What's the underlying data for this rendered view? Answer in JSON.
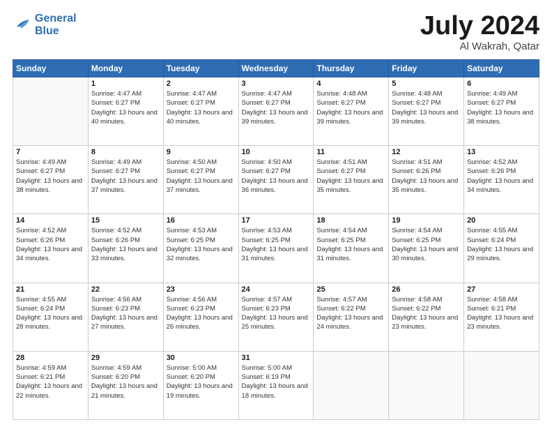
{
  "header": {
    "logo_line1": "General",
    "logo_line2": "Blue",
    "month": "July 2024",
    "location": "Al Wakrah, Qatar"
  },
  "weekdays": [
    "Sunday",
    "Monday",
    "Tuesday",
    "Wednesday",
    "Thursday",
    "Friday",
    "Saturday"
  ],
  "weeks": [
    [
      {
        "day": "",
        "sunrise": "",
        "sunset": "",
        "daylight": ""
      },
      {
        "day": "1",
        "sunrise": "Sunrise: 4:47 AM",
        "sunset": "Sunset: 6:27 PM",
        "daylight": "Daylight: 13 hours and 40 minutes."
      },
      {
        "day": "2",
        "sunrise": "Sunrise: 4:47 AM",
        "sunset": "Sunset: 6:27 PM",
        "daylight": "Daylight: 13 hours and 40 minutes."
      },
      {
        "day": "3",
        "sunrise": "Sunrise: 4:47 AM",
        "sunset": "Sunset: 6:27 PM",
        "daylight": "Daylight: 13 hours and 39 minutes."
      },
      {
        "day": "4",
        "sunrise": "Sunrise: 4:48 AM",
        "sunset": "Sunset: 6:27 PM",
        "daylight": "Daylight: 13 hours and 39 minutes."
      },
      {
        "day": "5",
        "sunrise": "Sunrise: 4:48 AM",
        "sunset": "Sunset: 6:27 PM",
        "daylight": "Daylight: 13 hours and 39 minutes."
      },
      {
        "day": "6",
        "sunrise": "Sunrise: 4:49 AM",
        "sunset": "Sunset: 6:27 PM",
        "daylight": "Daylight: 13 hours and 38 minutes."
      }
    ],
    [
      {
        "day": "7",
        "sunrise": "Sunrise: 4:49 AM",
        "sunset": "Sunset: 6:27 PM",
        "daylight": "Daylight: 13 hours and 38 minutes."
      },
      {
        "day": "8",
        "sunrise": "Sunrise: 4:49 AM",
        "sunset": "Sunset: 6:27 PM",
        "daylight": "Daylight: 13 hours and 37 minutes."
      },
      {
        "day": "9",
        "sunrise": "Sunrise: 4:50 AM",
        "sunset": "Sunset: 6:27 PM",
        "daylight": "Daylight: 13 hours and 37 minutes."
      },
      {
        "day": "10",
        "sunrise": "Sunrise: 4:50 AM",
        "sunset": "Sunset: 6:27 PM",
        "daylight": "Daylight: 13 hours and 36 minutes."
      },
      {
        "day": "11",
        "sunrise": "Sunrise: 4:51 AM",
        "sunset": "Sunset: 6:27 PM",
        "daylight": "Daylight: 13 hours and 35 minutes."
      },
      {
        "day": "12",
        "sunrise": "Sunrise: 4:51 AM",
        "sunset": "Sunset: 6:26 PM",
        "daylight": "Daylight: 13 hours and 35 minutes."
      },
      {
        "day": "13",
        "sunrise": "Sunrise: 4:52 AM",
        "sunset": "Sunset: 6:26 PM",
        "daylight": "Daylight: 13 hours and 34 minutes."
      }
    ],
    [
      {
        "day": "14",
        "sunrise": "Sunrise: 4:52 AM",
        "sunset": "Sunset: 6:26 PM",
        "daylight": "Daylight: 13 hours and 34 minutes."
      },
      {
        "day": "15",
        "sunrise": "Sunrise: 4:52 AM",
        "sunset": "Sunset: 6:26 PM",
        "daylight": "Daylight: 13 hours and 33 minutes."
      },
      {
        "day": "16",
        "sunrise": "Sunrise: 4:53 AM",
        "sunset": "Sunset: 6:25 PM",
        "daylight": "Daylight: 13 hours and 32 minutes."
      },
      {
        "day": "17",
        "sunrise": "Sunrise: 4:53 AM",
        "sunset": "Sunset: 6:25 PM",
        "daylight": "Daylight: 13 hours and 31 minutes."
      },
      {
        "day": "18",
        "sunrise": "Sunrise: 4:54 AM",
        "sunset": "Sunset: 6:25 PM",
        "daylight": "Daylight: 13 hours and 31 minutes."
      },
      {
        "day": "19",
        "sunrise": "Sunrise: 4:54 AM",
        "sunset": "Sunset: 6:25 PM",
        "daylight": "Daylight: 13 hours and 30 minutes."
      },
      {
        "day": "20",
        "sunrise": "Sunrise: 4:55 AM",
        "sunset": "Sunset: 6:24 PM",
        "daylight": "Daylight: 13 hours and 29 minutes."
      }
    ],
    [
      {
        "day": "21",
        "sunrise": "Sunrise: 4:55 AM",
        "sunset": "Sunset: 6:24 PM",
        "daylight": "Daylight: 13 hours and 28 minutes."
      },
      {
        "day": "22",
        "sunrise": "Sunrise: 4:56 AM",
        "sunset": "Sunset: 6:23 PM",
        "daylight": "Daylight: 13 hours and 27 minutes."
      },
      {
        "day": "23",
        "sunrise": "Sunrise: 4:56 AM",
        "sunset": "Sunset: 6:23 PM",
        "daylight": "Daylight: 13 hours and 26 minutes."
      },
      {
        "day": "24",
        "sunrise": "Sunrise: 4:57 AM",
        "sunset": "Sunset: 6:23 PM",
        "daylight": "Daylight: 13 hours and 25 minutes."
      },
      {
        "day": "25",
        "sunrise": "Sunrise: 4:57 AM",
        "sunset": "Sunset: 6:22 PM",
        "daylight": "Daylight: 13 hours and 24 minutes."
      },
      {
        "day": "26",
        "sunrise": "Sunrise: 4:58 AM",
        "sunset": "Sunset: 6:22 PM",
        "daylight": "Daylight: 13 hours and 23 minutes."
      },
      {
        "day": "27",
        "sunrise": "Sunrise: 4:58 AM",
        "sunset": "Sunset: 6:21 PM",
        "daylight": "Daylight: 13 hours and 23 minutes."
      }
    ],
    [
      {
        "day": "28",
        "sunrise": "Sunrise: 4:59 AM",
        "sunset": "Sunset: 6:21 PM",
        "daylight": "Daylight: 13 hours and 22 minutes."
      },
      {
        "day": "29",
        "sunrise": "Sunrise: 4:59 AM",
        "sunset": "Sunset: 6:20 PM",
        "daylight": "Daylight: 13 hours and 21 minutes."
      },
      {
        "day": "30",
        "sunrise": "Sunrise: 5:00 AM",
        "sunset": "Sunset: 6:20 PM",
        "daylight": "Daylight: 13 hours and 19 minutes."
      },
      {
        "day": "31",
        "sunrise": "Sunrise: 5:00 AM",
        "sunset": "Sunset: 6:19 PM",
        "daylight": "Daylight: 13 hours and 18 minutes."
      },
      {
        "day": "",
        "sunrise": "",
        "sunset": "",
        "daylight": ""
      },
      {
        "day": "",
        "sunrise": "",
        "sunset": "",
        "daylight": ""
      },
      {
        "day": "",
        "sunrise": "",
        "sunset": "",
        "daylight": ""
      }
    ]
  ]
}
